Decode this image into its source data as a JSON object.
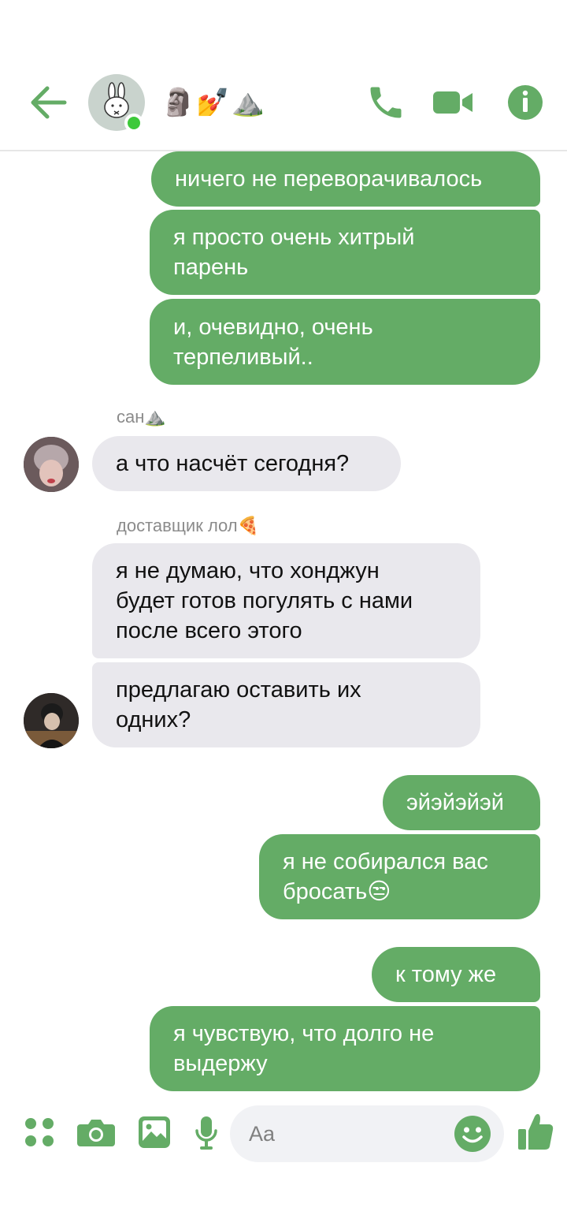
{
  "header": {
    "title": "🗿💅⛰️",
    "icons": [
      "back-arrow-icon",
      "group-avatar",
      "phone-icon",
      "video-camera-icon",
      "info-icon"
    ],
    "accent_color": "#64ac66"
  },
  "messages": [
    {
      "side": "out",
      "text": "ничего не переворачивалось"
    },
    {
      "side": "out",
      "text": "я просто очень хитрый\nпарень"
    },
    {
      "side": "out",
      "text": "и, очевидно, очень\nтерпеливый.."
    },
    {
      "side": "in",
      "sender": "сан⛰️",
      "text": "а что насчёт сегодня?"
    },
    {
      "side": "in",
      "sender": "доставщик лол🍕",
      "text": "я не думаю, что хонджун\nбудет готов погулять с нами\nпосле всего этого"
    },
    {
      "side": "in",
      "text": "предлагаю оставить их\nодних?"
    },
    {
      "side": "out",
      "text": "эйэйэйэй"
    },
    {
      "side": "out",
      "text": "я не собирался вас\nбросать😒"
    },
    {
      "side": "out",
      "text": "к тому же"
    },
    {
      "side": "out",
      "text": "я чувствую, что долго не\nвыдержу"
    }
  ],
  "composer": {
    "placeholder": "Aa",
    "icons": [
      "apps-grid-icon",
      "camera-icon",
      "gallery-icon",
      "microphone-icon",
      "emoji-icon",
      "thumbs-up-icon"
    ]
  }
}
